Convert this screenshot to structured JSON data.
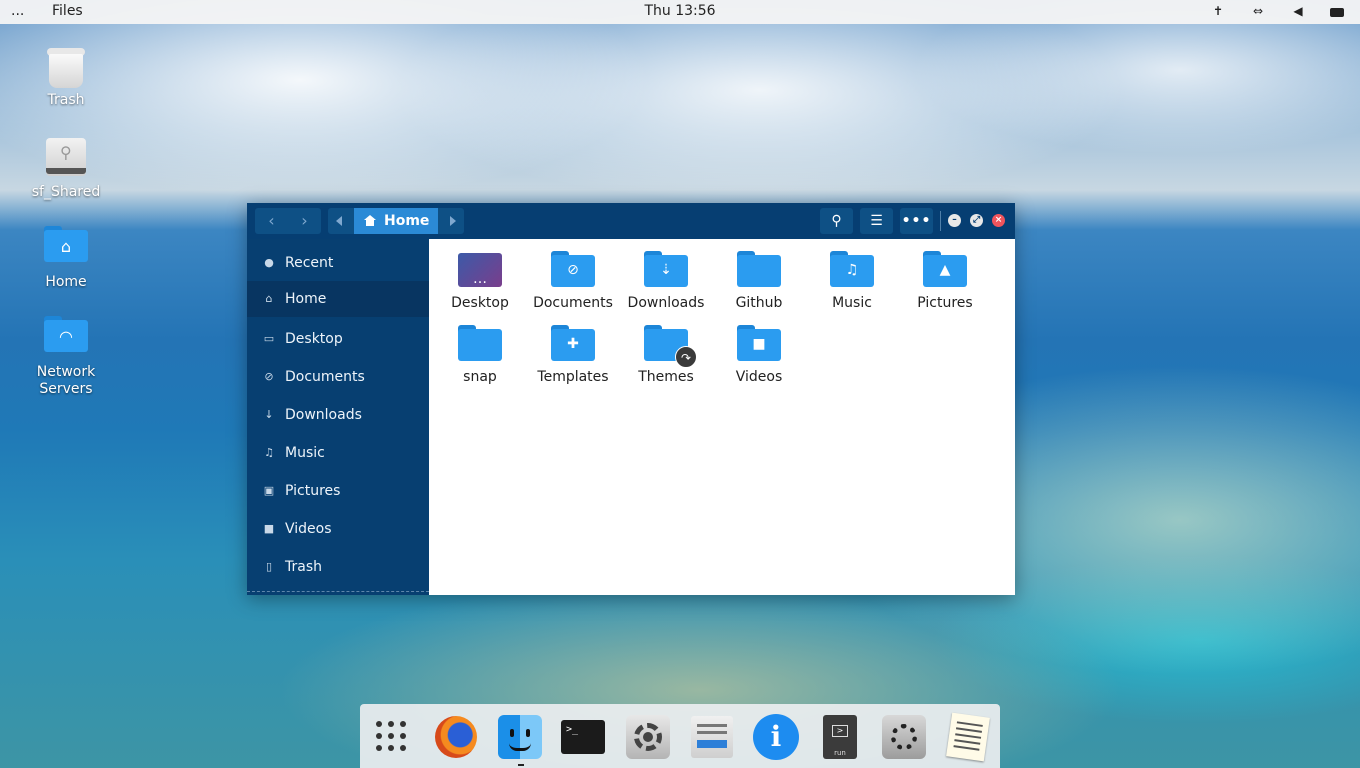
{
  "topbar": {
    "activities": "...",
    "app_name": "Files",
    "clock": "Thu 13:56",
    "tray_icons": [
      "accessibility-icon",
      "network-icon",
      "volume-icon",
      "battery-icon"
    ]
  },
  "desktop": {
    "icons": [
      {
        "label": "Trash",
        "icon": "trash-icon"
      },
      {
        "label": "sf_Shared",
        "icon": "usb-drive-icon"
      },
      {
        "label": "Home",
        "icon": "home-folder-icon"
      },
      {
        "label": "Network\nServers",
        "icon": "network-folder-icon"
      }
    ]
  },
  "window": {
    "path": {
      "current": "Home"
    },
    "sidebar": {
      "items": [
        {
          "label": "Recent",
          "icon": "clock-icon"
        },
        {
          "label": "Home",
          "icon": "home-icon",
          "active": true
        },
        {
          "label": "Desktop",
          "icon": "monitor-icon"
        },
        {
          "label": "Documents",
          "icon": "paperclip-icon"
        },
        {
          "label": "Downloads",
          "icon": "download-icon"
        },
        {
          "label": "Music",
          "icon": "music-icon"
        },
        {
          "label": "Pictures",
          "icon": "picture-icon"
        },
        {
          "label": "Videos",
          "icon": "video-icon"
        },
        {
          "label": "Trash",
          "icon": "trash-icon"
        }
      ]
    },
    "files": [
      {
        "label": "Desktop",
        "icon": "desktop-folder-icon"
      },
      {
        "label": "Documents",
        "icon": "documents-folder-icon"
      },
      {
        "label": "Downloads",
        "icon": "downloads-folder-icon"
      },
      {
        "label": "Github",
        "icon": "folder-icon"
      },
      {
        "label": "Music",
        "icon": "music-folder-icon"
      },
      {
        "label": "Pictures",
        "icon": "pictures-folder-icon"
      },
      {
        "label": "snap",
        "icon": "folder-icon"
      },
      {
        "label": "Templates",
        "icon": "templates-folder-icon"
      },
      {
        "label": "Themes",
        "icon": "symlink-folder-icon"
      },
      {
        "label": "Videos",
        "icon": "videos-folder-icon"
      }
    ],
    "colors": {
      "headerbar": "#063e72",
      "sidebar": "#073f71",
      "accent": "#2b8ad6",
      "folder": "#2b9cf0",
      "close": "#f0545c"
    }
  },
  "dock": {
    "apps": [
      "app-grid-icon",
      "firefox-icon",
      "files-icon",
      "terminal-icon",
      "settings-icon",
      "disks-icon",
      "info-icon",
      "run-icon",
      "tweaks-icon",
      "notes-icon"
    ],
    "run_label": "run",
    "terminal_prompt": ">_"
  }
}
